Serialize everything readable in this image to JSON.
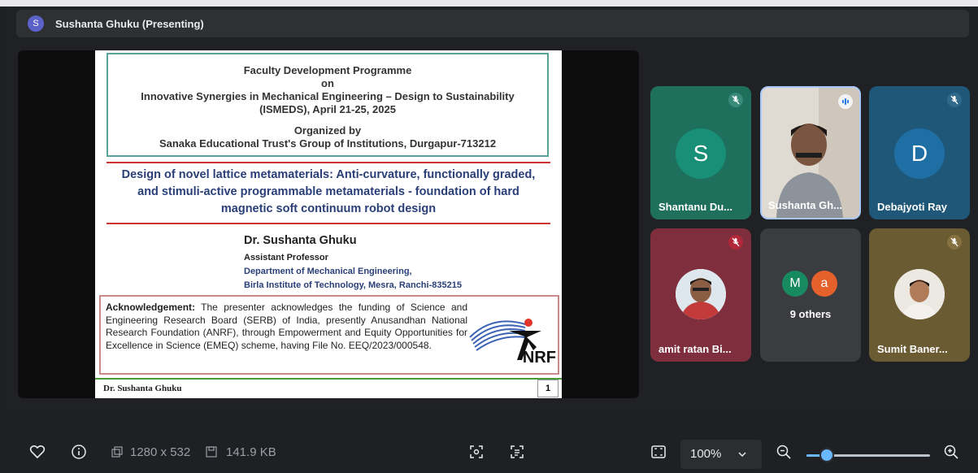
{
  "presenter_bar": {
    "avatar_letter": "S",
    "label": "Sushanta Ghuku (Presenting)"
  },
  "slide": {
    "box_lines": [
      "Faculty Development Programme",
      "on",
      "Innovative Synergies in Mechanical Engineering – Design to Sustainability",
      "(ISMEDS), April 21-25, 2025",
      "Organized by",
      "Sanaka Educational Trust's Group of Institutions, Durgapur-713212"
    ],
    "talk_title": [
      "Design of novel lattice metamaterials: Anti-curvature, functionally graded,",
      "and stimuli-active programmable metamaterials - foundation of hard",
      "magnetic soft continuum robot design"
    ],
    "author": "Dr. Sushanta Ghuku",
    "role": "Assistant Professor",
    "department": "Department of Mechanical Engineering,",
    "institute": "Birla Institute of Technology, Mesra, Ranchi-835215",
    "ack_heading": "Acknowledgement:",
    "ack_body": " The presenter acknowledges the funding of Science and Engineering Research Board (SERB) of India, presently Anusandhan National Research Foundation (ANRF), through Empowerment and Equity Opportunities for Excellence in Science (EMEQ) scheme, having File No. EEQ/2023/000548.",
    "logo_text": "NRF",
    "footer_name": "Dr. Sushanta Ghuku",
    "page_number": "1"
  },
  "participants": [
    {
      "name": "Shantanu Du...",
      "initial": "S",
      "muted": true
    },
    {
      "name": "Sushanta Gh...",
      "speaking": true
    },
    {
      "name": "Debajyoti Ray",
      "initial": "D",
      "muted": true
    },
    {
      "name": "amit ratan Bi...",
      "muted": true
    },
    {
      "others_label": "9 others",
      "initials": [
        "M",
        "a"
      ]
    },
    {
      "name": "Sumit Baner...",
      "muted": true
    }
  ],
  "bottom_bar": {
    "dimensions": "1280 x 532",
    "file_size": "141.9 KB",
    "zoom_level": "100%",
    "zoom_slider_fraction": 0.17
  },
  "colors": {
    "accent": "#6ab8ff",
    "tile_teal": "#1f6f5d",
    "tile_blue": "#1e5777",
    "tile_maroon": "#7e2e3c",
    "tile_grey": "#3b3c40",
    "tile_olive": "#6b5b32",
    "avatar_teal": "#1a8f78",
    "avatar_blue": "#1f6fa5",
    "avatar_green": "#178a61",
    "avatar_orange": "#e4612c"
  }
}
